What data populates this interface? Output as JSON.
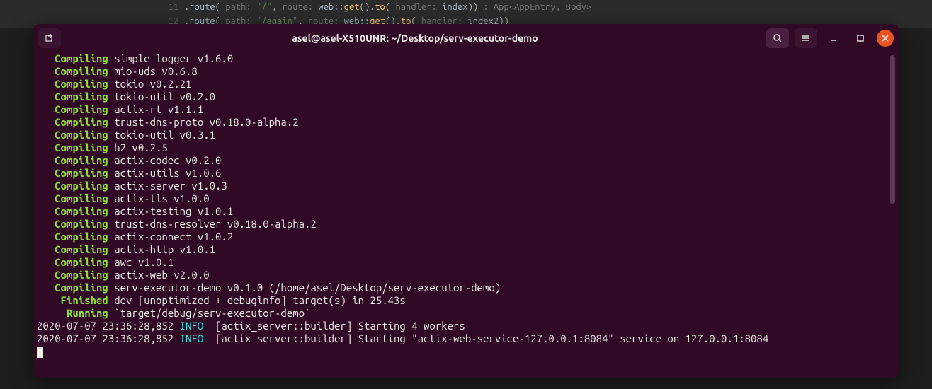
{
  "editor": {
    "lines": [
      {
        "num": "11",
        "indent": "                    ",
        "method": ".route(",
        "h1": " path: ",
        "str": "\"/\"",
        "mid": ",   ",
        "h2": "route: ",
        "web": "web::",
        "get": "get",
        "par": "().",
        "to": "to",
        "par2": "( ",
        "h3": "handler: ",
        "idx": "index",
        "end": "))",
        "after": "  : App<AppEntry, Body>"
      },
      {
        "num": "12",
        "indent": "                    ",
        "method": ".route(",
        "h1": " path: ",
        "str": "\"/again\"",
        "mid": ", ",
        "h2": "route: ",
        "web": "web::",
        "get": "get",
        "par": "().",
        "to": "to",
        "par2": "( ",
        "h3": "handler: ",
        "idx": "index2",
        "end": "))",
        "after": ""
      }
    ]
  },
  "titlebar": {
    "title": "asel@asel-X510UNR: ~/Desktop/serv-executor-demo"
  },
  "compiling_label": "Compiling",
  "finished_label": "Finished",
  "running_label": "Running",
  "info_label": "INFO",
  "lines": [
    {
      "kind": "compile",
      "pkg": "simple_logger v1.6.0"
    },
    {
      "kind": "compile",
      "pkg": "mio-uds v0.6.8"
    },
    {
      "kind": "compile",
      "pkg": "tokio v0.2.21"
    },
    {
      "kind": "compile",
      "pkg": "tokio-util v0.2.0"
    },
    {
      "kind": "compile",
      "pkg": "actix-rt v1.1.1"
    },
    {
      "kind": "compile",
      "pkg": "trust-dns-proto v0.18.0-alpha.2"
    },
    {
      "kind": "compile",
      "pkg": "tokio-util v0.3.1"
    },
    {
      "kind": "compile",
      "pkg": "h2 v0.2.5"
    },
    {
      "kind": "compile",
      "pkg": "actix-codec v0.2.0"
    },
    {
      "kind": "compile",
      "pkg": "actix-utils v1.0.6"
    },
    {
      "kind": "compile",
      "pkg": "actix-server v1.0.3"
    },
    {
      "kind": "compile",
      "pkg": "actix-tls v1.0.0"
    },
    {
      "kind": "compile",
      "pkg": "actix-testing v1.0.1"
    },
    {
      "kind": "compile",
      "pkg": "trust-dns-resolver v0.18.0-alpha.2"
    },
    {
      "kind": "compile",
      "pkg": "actix-connect v1.0.2"
    },
    {
      "kind": "compile",
      "pkg": "actix-http v1.0.1"
    },
    {
      "kind": "compile",
      "pkg": "awc v1.0.1"
    },
    {
      "kind": "compile",
      "pkg": "actix-web v2.0.0"
    },
    {
      "kind": "compile",
      "pkg": "serv-executor-demo v0.1.0 (/home/asel/Desktop/serv-executor-demo)"
    }
  ],
  "finished_text": "dev [unoptimized + debuginfo] target(s) in 25.43s",
  "running_text": "`target/debug/serv-executor-demo`",
  "logs": [
    {
      "ts": "2020-07-07 23:36:28,852",
      "body": " [actix_server::builder] Starting 4 workers"
    },
    {
      "ts": "2020-07-07 23:36:28,852",
      "body": " [actix_server::builder] Starting \"actix-web-service-127.0.0.1:8084\" service on 127.0.0.1:8084"
    }
  ]
}
